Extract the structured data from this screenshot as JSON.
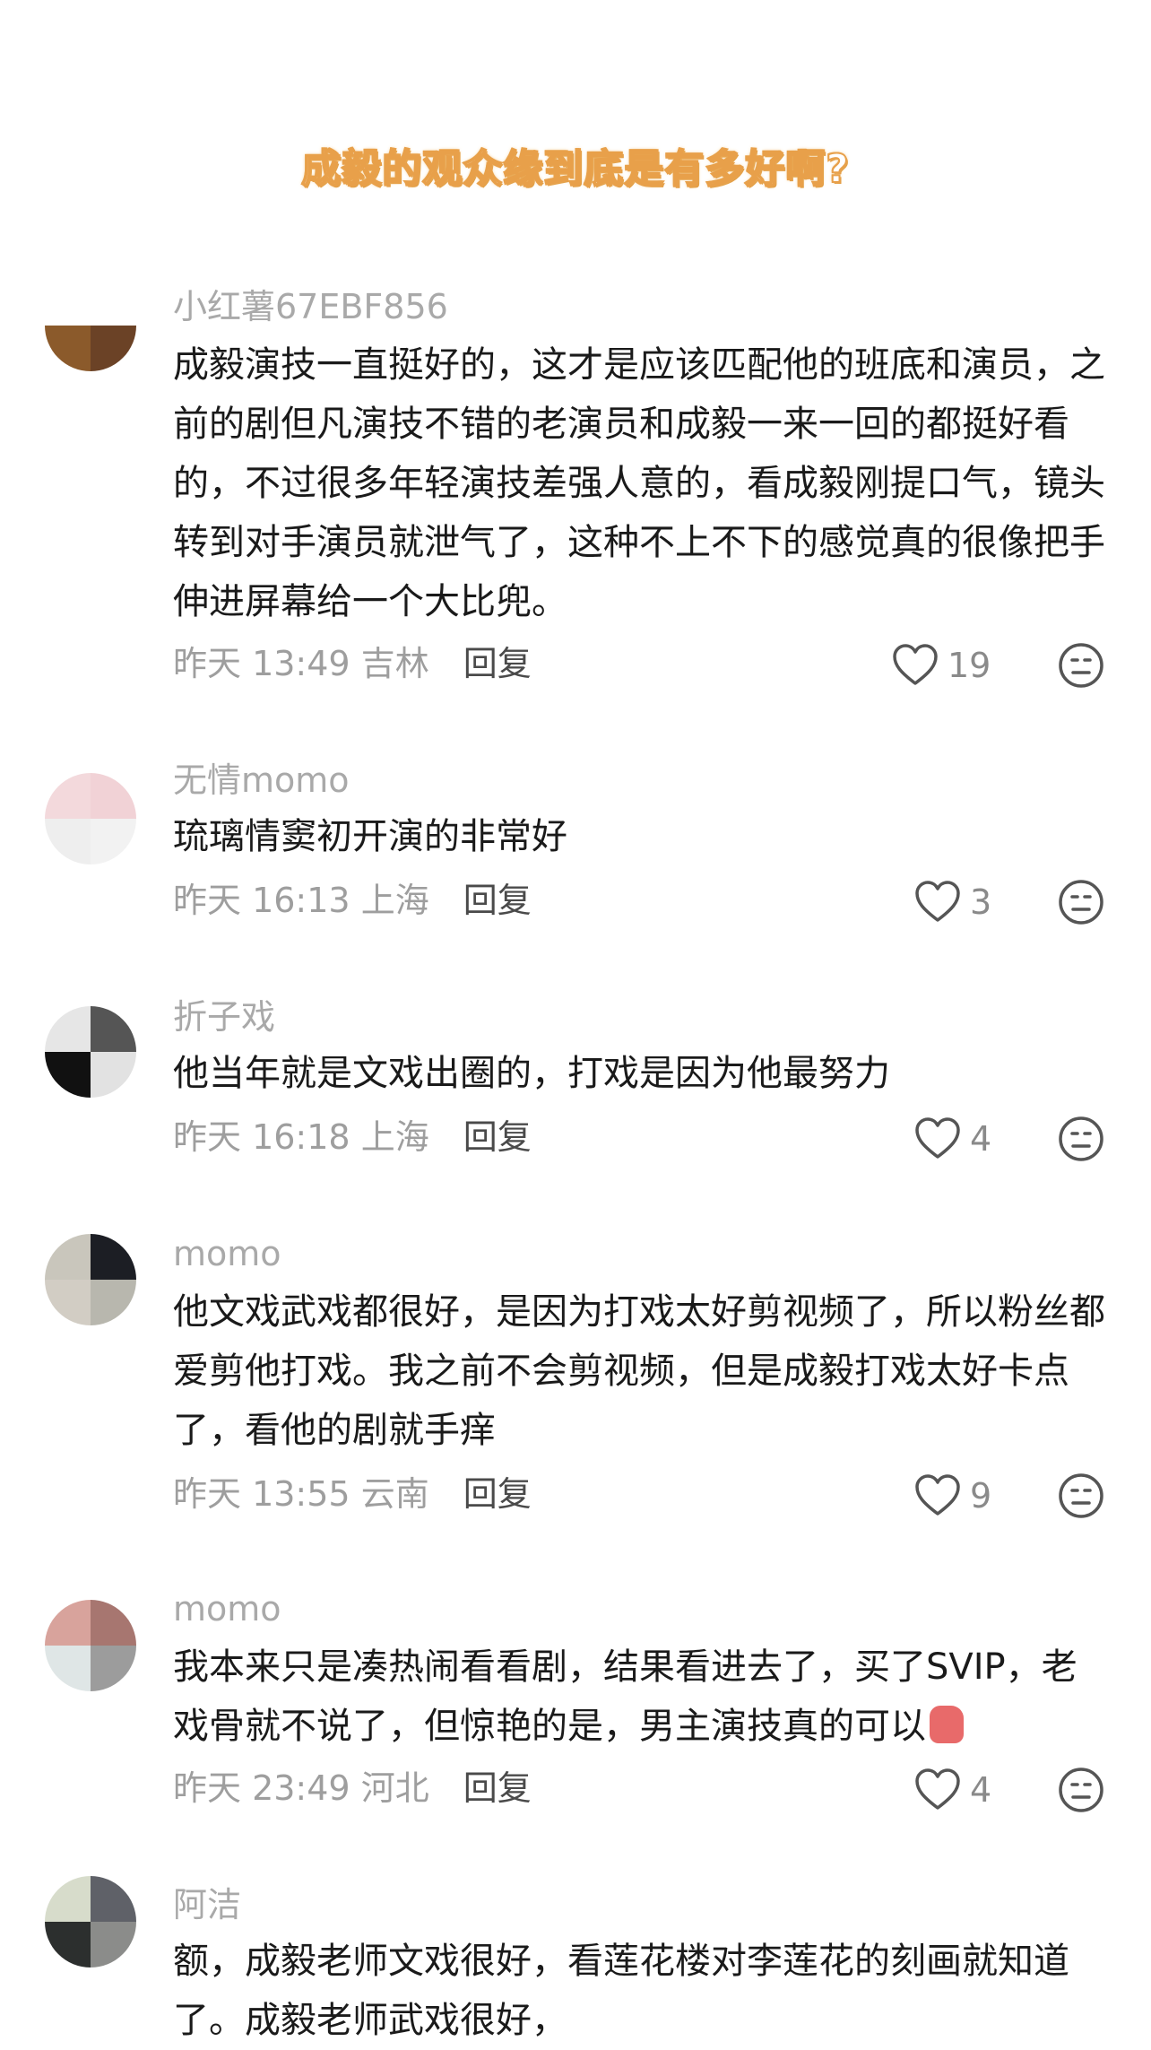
{
  "title": "成毅的观众缘到底是有多好啊?",
  "comments": [
    {
      "user": "小红薯67EBF856",
      "text": "成毅演技一直挺好的，这才是应该匹配他的班底和演员，之前的剧但凡演技不错的老演员和成毅一来一回的都挺好看的，不过很多年轻演技差强人意的，看成毅刚提口气，镜头转到对手演员就泄气了，这种不上不下的感觉真的很像把手伸进屏幕给一个大比兜。",
      "time": "昨天 13:49",
      "location": "吉林",
      "reply": "回复",
      "likes": "19",
      "avatar_colors": [
        "#ffffff",
        "#ffffff",
        "#8b5a2b",
        "#6b4226"
      ]
    },
    {
      "user": "无情momo",
      "text": "琉璃情窦初开演的非常好",
      "time": "昨天 16:13",
      "location": "上海",
      "reply": "回复",
      "likes": "3",
      "avatar_colors": [
        "#f3d9dc",
        "#f1d2d6",
        "#eeeeee",
        "#f2f2f2"
      ]
    },
    {
      "user": "折子戏",
      "text": "他当年就是文戏出圈的，打戏是因为他最努力",
      "time": "昨天 16:18",
      "location": "上海",
      "reply": "回复",
      "likes": "4",
      "avatar_colors": [
        "#e6e6e6",
        "#555555",
        "#111111",
        "#e2e2e2"
      ]
    },
    {
      "user": "momo",
      "text": "他文戏武戏都很好，是因为打戏太好剪视频了，所以粉丝都爱剪他打戏。我之前不会剪视频，但是成毅打戏太好卡点了，看他的剧就手痒",
      "time": "昨天 13:55",
      "location": "云南",
      "reply": "回复",
      "likes": "9",
      "avatar_colors": [
        "#c9c6bc",
        "#1c1e24",
        "#d2cdc4",
        "#b8b7ae"
      ]
    },
    {
      "user": "momo",
      "text": "我本来只是凑热闹看看剧，结果看进去了，买了SVIP，老戏骨就不说了，但惊艳的是，男主演技真的可以",
      "emoji": "thumbs-up",
      "time": "昨天 23:49",
      "location": "河北",
      "reply": "回复",
      "likes": "4",
      "avatar_colors": [
        "#d8a39c",
        "#a77670",
        "#dfe6e6",
        "#9c9c9c"
      ]
    },
    {
      "user": "阿洁",
      "text": "额，成毅老师文戏很好，看莲花楼对李莲花的刻画就知道了。成毅老师武戏很好，",
      "avatar_colors": [
        "#d7dccb",
        "#5f6168",
        "#2c2f2e",
        "#8b8c8a"
      ]
    }
  ],
  "icons": {
    "like": "heart-outline-icon",
    "dislike": "neutral-face-icon"
  },
  "colors": {
    "username": "#a9a9a9",
    "meta": "#9e9e9e",
    "text": "#1a1a1a",
    "title_stroke": "#e8a04a"
  }
}
